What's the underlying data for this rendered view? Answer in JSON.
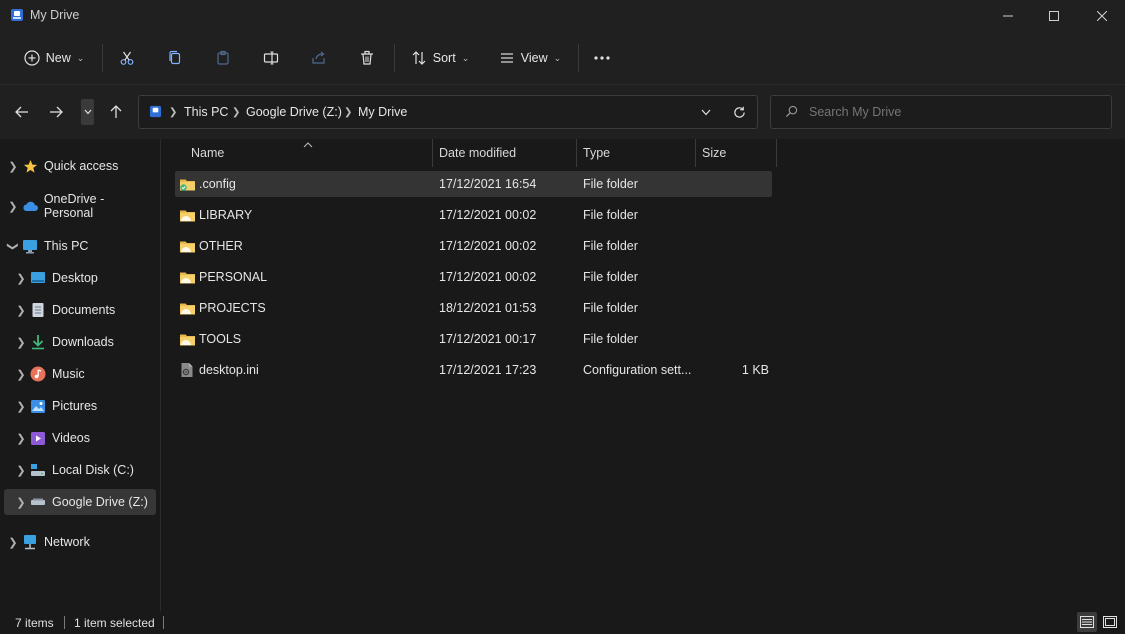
{
  "window": {
    "title": "My Drive"
  },
  "toolbar": {
    "new_label": "New",
    "sort_label": "Sort",
    "view_label": "View"
  },
  "address": {
    "crumbs": [
      "This PC",
      "Google Drive (Z:)",
      "My Drive"
    ]
  },
  "search": {
    "placeholder": "Search My Drive"
  },
  "sidebar": {
    "items": [
      {
        "label": "Quick access",
        "icon": "star-icon"
      },
      {
        "label": "OneDrive - Personal",
        "icon": "cloud-icon"
      },
      {
        "label": "This PC",
        "icon": "monitor-icon"
      },
      {
        "label": "Desktop",
        "icon": "desktop-icon"
      },
      {
        "label": "Documents",
        "icon": "document-icon"
      },
      {
        "label": "Downloads",
        "icon": "download-icon"
      },
      {
        "label": "Music",
        "icon": "music-icon"
      },
      {
        "label": "Pictures",
        "icon": "pictures-icon"
      },
      {
        "label": "Videos",
        "icon": "videos-icon"
      },
      {
        "label": "Local Disk (C:)",
        "icon": "disk-icon"
      },
      {
        "label": "Google Drive (Z:)",
        "icon": "drive-icon"
      },
      {
        "label": "Network",
        "icon": "network-icon"
      }
    ]
  },
  "columns": {
    "name": "Name",
    "date": "Date modified",
    "type": "Type",
    "size": "Size"
  },
  "files": [
    {
      "name": ".config",
      "date": "17/12/2021 16:54",
      "type": "File folder",
      "size": "",
      "icon": "folder-synced-icon"
    },
    {
      "name": "LIBRARY",
      "date": "17/12/2021 00:02",
      "type": "File folder",
      "size": "",
      "icon": "folder-icon"
    },
    {
      "name": "OTHER",
      "date": "17/12/2021 00:02",
      "type": "File folder",
      "size": "",
      "icon": "folder-icon"
    },
    {
      "name": "PERSONAL",
      "date": "17/12/2021 00:02",
      "type": "File folder",
      "size": "",
      "icon": "folder-icon"
    },
    {
      "name": "PROJECTS",
      "date": "18/12/2021 01:53",
      "type": "File folder",
      "size": "",
      "icon": "folder-icon"
    },
    {
      "name": "TOOLS",
      "date": "17/12/2021 00:17",
      "type": "File folder",
      "size": "",
      "icon": "folder-icon"
    },
    {
      "name": "desktop.ini",
      "date": "17/12/2021 17:23",
      "type": "Configuration sett...",
      "size": "1 KB",
      "icon": "settings-file-icon"
    }
  ],
  "status": {
    "count": "7 items",
    "selection": "1 item selected"
  },
  "colors": {
    "background": "#191919",
    "chrome": "#202020",
    "selected": "#343434",
    "folder": "#e8b84a"
  }
}
